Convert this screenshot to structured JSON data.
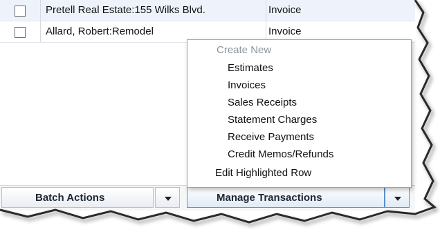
{
  "transactions": {
    "rows": [
      {
        "name": "Pretell Real Estate:155 Wilks Blvd.",
        "type": "Invoice"
      },
      {
        "name": "Allard, Robert:Remodel",
        "type": "Invoice"
      }
    ]
  },
  "context_menu": {
    "header": "Create New",
    "items": [
      "Estimates",
      "Invoices",
      "Sales Receipts",
      "Statement Charges",
      "Receive Payments",
      "Credit Memos/Refunds"
    ],
    "edit_row": "Edit Highlighted Row"
  },
  "toolbar": {
    "batch_actions_label": "Batch Actions",
    "manage_transactions_label": "Manage Transactions"
  },
  "colors": {
    "row_highlight": "#eef3fb",
    "menu_header": "#8d949c",
    "button_accent_border": "#5c92c9"
  },
  "icons": {
    "batch_dropdown": "chevron-down-icon",
    "manage_dropdown": "chevron-down-icon"
  }
}
